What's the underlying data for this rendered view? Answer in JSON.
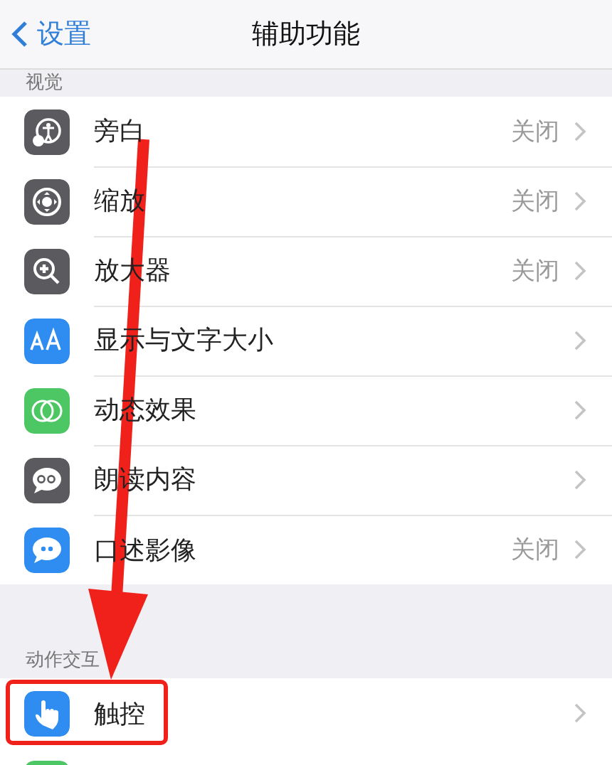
{
  "nav": {
    "back": "设置",
    "title": "辅助功能"
  },
  "sections": [
    {
      "header": "视觉",
      "rows": [
        {
          "label": "旁白",
          "value": "关闭",
          "kind": "voiceover",
          "color": "#5b5b5f",
          "highlighted": false
        },
        {
          "label": "缩放",
          "value": "关闭",
          "kind": "zoom",
          "color": "#5b5b5f",
          "highlighted": false
        },
        {
          "label": "放大器",
          "value": "关闭",
          "kind": "magnifier",
          "color": "#5b5b5f",
          "highlighted": false
        },
        {
          "label": "显示与文字大小",
          "kind": "textsize",
          "color": "#2f8cf0",
          "highlighted": false
        },
        {
          "label": "动态效果",
          "kind": "motion",
          "color": "#4cc764",
          "highlighted": false
        },
        {
          "label": "朗读内容",
          "kind": "speech",
          "color": "#5b5b5f",
          "highlighted": false
        },
        {
          "label": "口述影像",
          "value": "关闭",
          "kind": "description",
          "color": "#2f8cf0",
          "highlighted": false
        }
      ]
    },
    {
      "header": "动作交互",
      "rows": [
        {
          "label": "触控",
          "kind": "touch",
          "color": "#2f8cf0",
          "highlighted": true
        }
      ]
    }
  ]
}
